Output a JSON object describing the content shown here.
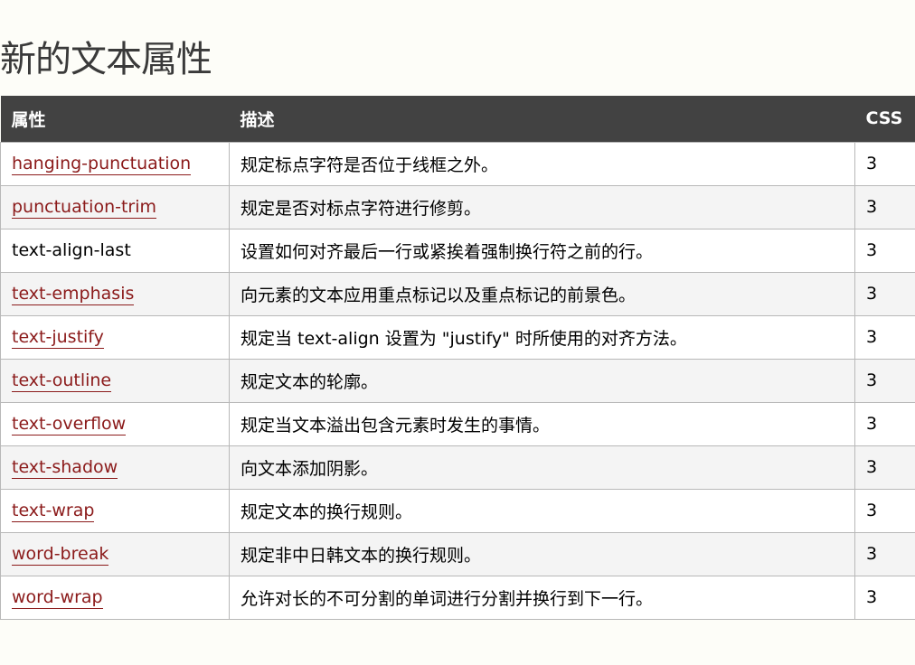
{
  "title": "新的文本属性",
  "table": {
    "headers": {
      "property": "属性",
      "description": "描述",
      "css": "CSS"
    },
    "rows": [
      {
        "property": "hanging-punctuation",
        "linked": true,
        "description": "规定标点字符是否位于线框之外。",
        "css": "3"
      },
      {
        "property": "punctuation-trim",
        "linked": true,
        "description": "规定是否对标点字符进行修剪。",
        "css": "3"
      },
      {
        "property": "text-align-last",
        "linked": false,
        "description": "设置如何对齐最后一行或紧挨着强制换行符之前的行。",
        "css": "3"
      },
      {
        "property": "text-emphasis",
        "linked": true,
        "description": "向元素的文本应用重点标记以及重点标记的前景色。",
        "css": "3"
      },
      {
        "property": "text-justify",
        "linked": true,
        "description": "规定当 text-align 设置为 \"justify\" 时所使用的对齐方法。",
        "css": "3"
      },
      {
        "property": "text-outline",
        "linked": true,
        "description": "规定文本的轮廓。",
        "css": "3"
      },
      {
        "property": "text-overflow",
        "linked": true,
        "description": "规定当文本溢出包含元素时发生的事情。",
        "css": "3"
      },
      {
        "property": "text-shadow",
        "linked": true,
        "description": "向文本添加阴影。",
        "css": "3"
      },
      {
        "property": "text-wrap",
        "linked": true,
        "description": "规定文本的换行规则。",
        "css": "3"
      },
      {
        "property": "word-break",
        "linked": true,
        "description": "规定非中日韩文本的换行规则。",
        "css": "3"
      },
      {
        "property": "word-wrap",
        "linked": true,
        "description": "允许对长的不可分割的单词进行分割并换行到下一行。",
        "css": "3"
      }
    ]
  },
  "colors": {
    "header_bg": "#424242",
    "link": "#8b1a1a",
    "page_bg": "#fdfdf8"
  }
}
